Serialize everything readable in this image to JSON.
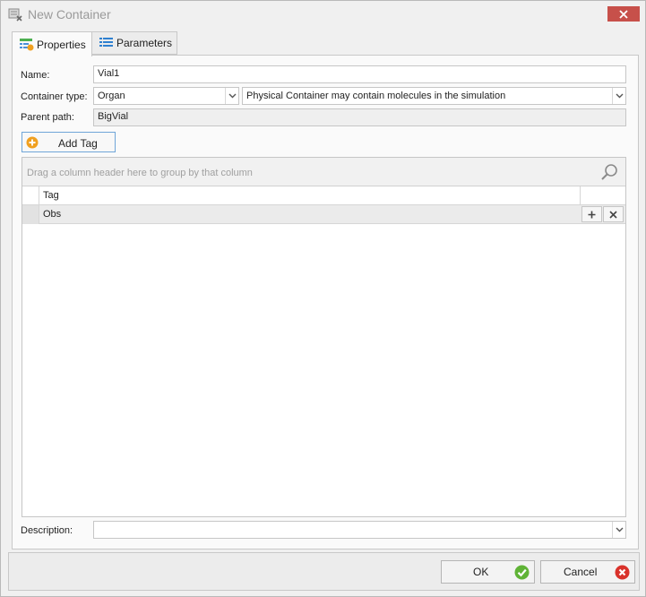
{
  "window": {
    "title": "New Container",
    "close_icon": "close-icon",
    "app_icon": "container-edit-icon"
  },
  "tabs": [
    {
      "label": "Properties",
      "icon": "properties-icon",
      "active": true
    },
    {
      "label": "Parameters",
      "icon": "parameters-icon",
      "active": false
    }
  ],
  "form": {
    "name_label": "Name:",
    "name_value": "Vial1",
    "container_type_label": "Container type:",
    "container_type_value": "Organ",
    "mode_value": "Physical Container may contain molecules in the simulation",
    "parent_path_label": "Parent path:",
    "parent_path_value": "BigVial",
    "description_label": "Description:",
    "description_value": ""
  },
  "tags": {
    "add_tag_label": "Add Tag",
    "group_panel_text": "Drag a column header here to group by that column",
    "column_header": "Tag",
    "rows": [
      {
        "tag": "Obs"
      }
    ]
  },
  "footer": {
    "ok_label": "OK",
    "cancel_label": "Cancel"
  },
  "colors": {
    "accent": "#6fa5d8",
    "ok_green": "#5fb336",
    "cancel_red": "#d9322b",
    "close_red": "#c7504a"
  }
}
